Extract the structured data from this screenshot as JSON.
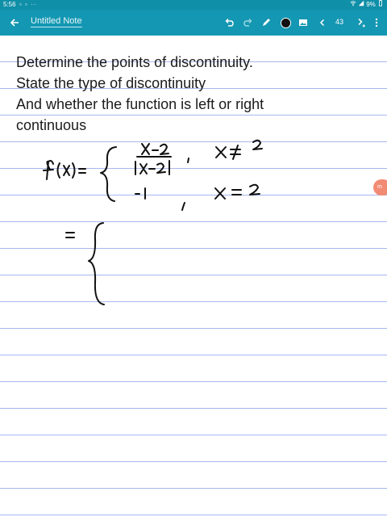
{
  "status_bar": {
    "time": "5:56",
    "notification_dots": "▫ ▫ ··",
    "battery": "9%"
  },
  "toolbar": {
    "note_title": "Untitled Note",
    "page_number": "43",
    "pen_color": "#111111"
  },
  "note": {
    "lines": [
      "Determine the points of discontinuity.",
      "State the type of discontinuity",
      "And whether the function is left or right",
      "continuous"
    ]
  },
  "side_badge": {
    "label": "m"
  },
  "colors": {
    "toolbar": "#1497b2",
    "status_bar": "#0f8fa8",
    "ruled_line": "#a9b8ee",
    "ink": "#111111",
    "badge": "#f28b73"
  }
}
